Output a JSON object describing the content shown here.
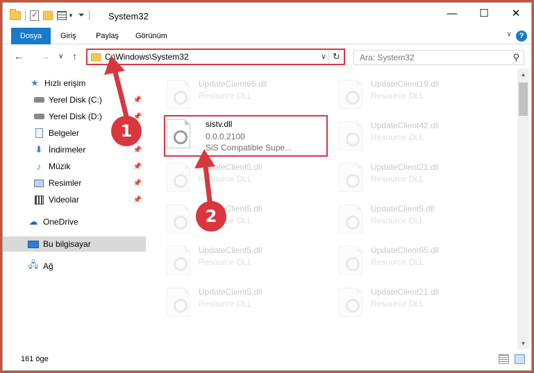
{
  "window": {
    "title": "System32",
    "minimize_glyph": "—",
    "maximize_glyph": "☐",
    "close_glyph": "✕"
  },
  "ribbon": {
    "tabs": [
      {
        "label": "Dosya",
        "active": true
      },
      {
        "label": "Giriş",
        "active": false
      },
      {
        "label": "Paylaş",
        "active": false
      },
      {
        "label": "Görünüm",
        "active": false
      }
    ],
    "help_glyph": "?",
    "collapse_glyph": "∨"
  },
  "navigation": {
    "back_glyph": "←",
    "forward_glyph": "→",
    "recent_glyph": "∨",
    "up_glyph": "↑",
    "address": "C:\\Windows\\System32",
    "address_dropdown_glyph": "∨",
    "refresh_glyph": "↻",
    "search_placeholder": "Ara: System32",
    "search_glyph": "⚲"
  },
  "sidebar": {
    "items": [
      {
        "label": "Hızlı erişim",
        "icon": "star-icon",
        "pinned": false
      },
      {
        "label": "Yerel Disk (C:)",
        "icon": "disk-icon",
        "pinned": true
      },
      {
        "label": "Yerel Disk (D:)",
        "icon": "disk-icon",
        "pinned": true
      },
      {
        "label": "Belgeler",
        "icon": "document-icon",
        "pinned": true
      },
      {
        "label": "İndirmeler",
        "icon": "download-icon",
        "pinned": true
      },
      {
        "label": "Müzik",
        "icon": "music-icon",
        "pinned": true
      },
      {
        "label": "Resimler",
        "icon": "pictures-icon",
        "pinned": true
      },
      {
        "label": "Videolar",
        "icon": "videos-icon",
        "pinned": true
      },
      {
        "label": "OneDrive",
        "icon": "cloud-icon",
        "pinned": false
      },
      {
        "label": "Bu bilgisayar",
        "icon": "computer-icon",
        "pinned": false,
        "selected": true
      },
      {
        "label": "Ağ",
        "icon": "network-icon",
        "pinned": false
      }
    ],
    "pin_glyph": "📌"
  },
  "files": {
    "highlighted": {
      "name": "sistv.dll",
      "version": "0.0.0.2100",
      "description": "SiS Compatible Supe..."
    },
    "background": [
      {
        "name": "UpdateClient65.dll",
        "type": "Resource DLL"
      },
      {
        "name": "UpdateClient19.dll",
        "type": "Resource DLL"
      },
      {
        "name": "UpdateClient42.dll",
        "type": "Resource DLL"
      },
      {
        "name": "UpdateClient5.dll",
        "type": "Resource DLL"
      },
      {
        "name": "UpdateClient21.dll",
        "type": "Resource DLL"
      },
      {
        "name": "UpdateClient5.dll",
        "type": "Resource DLL"
      },
      {
        "name": "UpdateClient5.dll",
        "type": "Resource DLL"
      },
      {
        "name": "UpdateClient5.dll",
        "type": "Resource DLL"
      },
      {
        "name": "UpdateClient65.dll",
        "type": "Resource DLL"
      },
      {
        "name": "UpdateClient5.dll",
        "type": "Resource DLL"
      },
      {
        "name": "UpdateClient21.dll",
        "type": "Resource DLL"
      }
    ]
  },
  "status": {
    "item_count": "161 öge"
  },
  "annotations": {
    "step1": "1",
    "step2": "2",
    "color": "#d9363e"
  },
  "scroll": {
    "up_glyph": "▲",
    "down_glyph": "▼"
  }
}
